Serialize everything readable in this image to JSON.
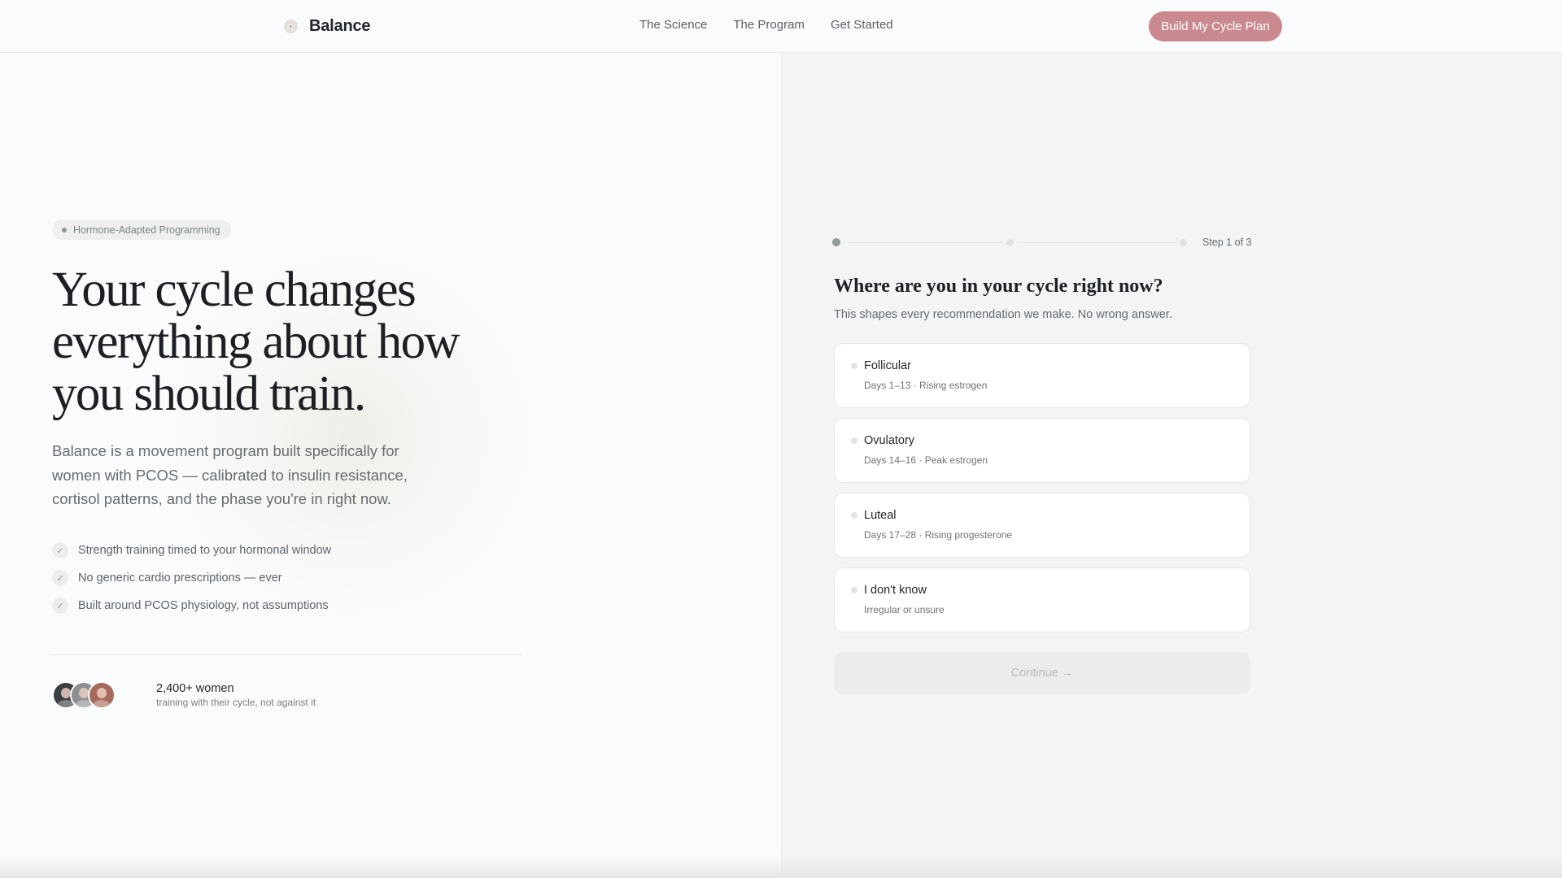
{
  "header": {
    "brand": "Balance",
    "nav": [
      "The Science",
      "The Program",
      "Get Started"
    ],
    "cta": "Build My Cycle Plan"
  },
  "hero": {
    "pill": "Hormone-Adapted Programming",
    "title_lines": [
      "Your cycle changes",
      "everything about how",
      "you should train."
    ],
    "description": "Balance is a movement program built specifically for women with PCOS — calibrated to insulin resistance, cortisol patterns, and the phase you're in right now.",
    "features": [
      "Strength training timed to your hormonal window",
      "No generic cardio prescriptions — ever",
      "Built around PCOS physiology, not assumptions"
    ],
    "social_proof": {
      "count": "2,400+ women",
      "subtitle": "training with their cycle, not against it"
    }
  },
  "quiz": {
    "step_label": "Step 1 of 3",
    "current_step": 1,
    "total_steps": 3,
    "question": "Where are you in your cycle right now?",
    "subtitle": "This shapes every recommendation we make. No wrong answer.",
    "options": [
      {
        "title": "Follicular",
        "subtitle": "Days 1–13 · Rising estrogen"
      },
      {
        "title": "Ovulatory",
        "subtitle": "Days 14–16 · Peak estrogen"
      },
      {
        "title": "Luteal",
        "subtitle": "Days 17–28 · Rising progesterone"
      },
      {
        "title": "I don't know",
        "subtitle": "Irregular or unsure"
      }
    ],
    "continue_label": "Continue →",
    "continue_enabled": false
  },
  "colors": {
    "accent": "#c9898f",
    "sage": "#8e9e94",
    "panel": "#f2f4f5"
  }
}
